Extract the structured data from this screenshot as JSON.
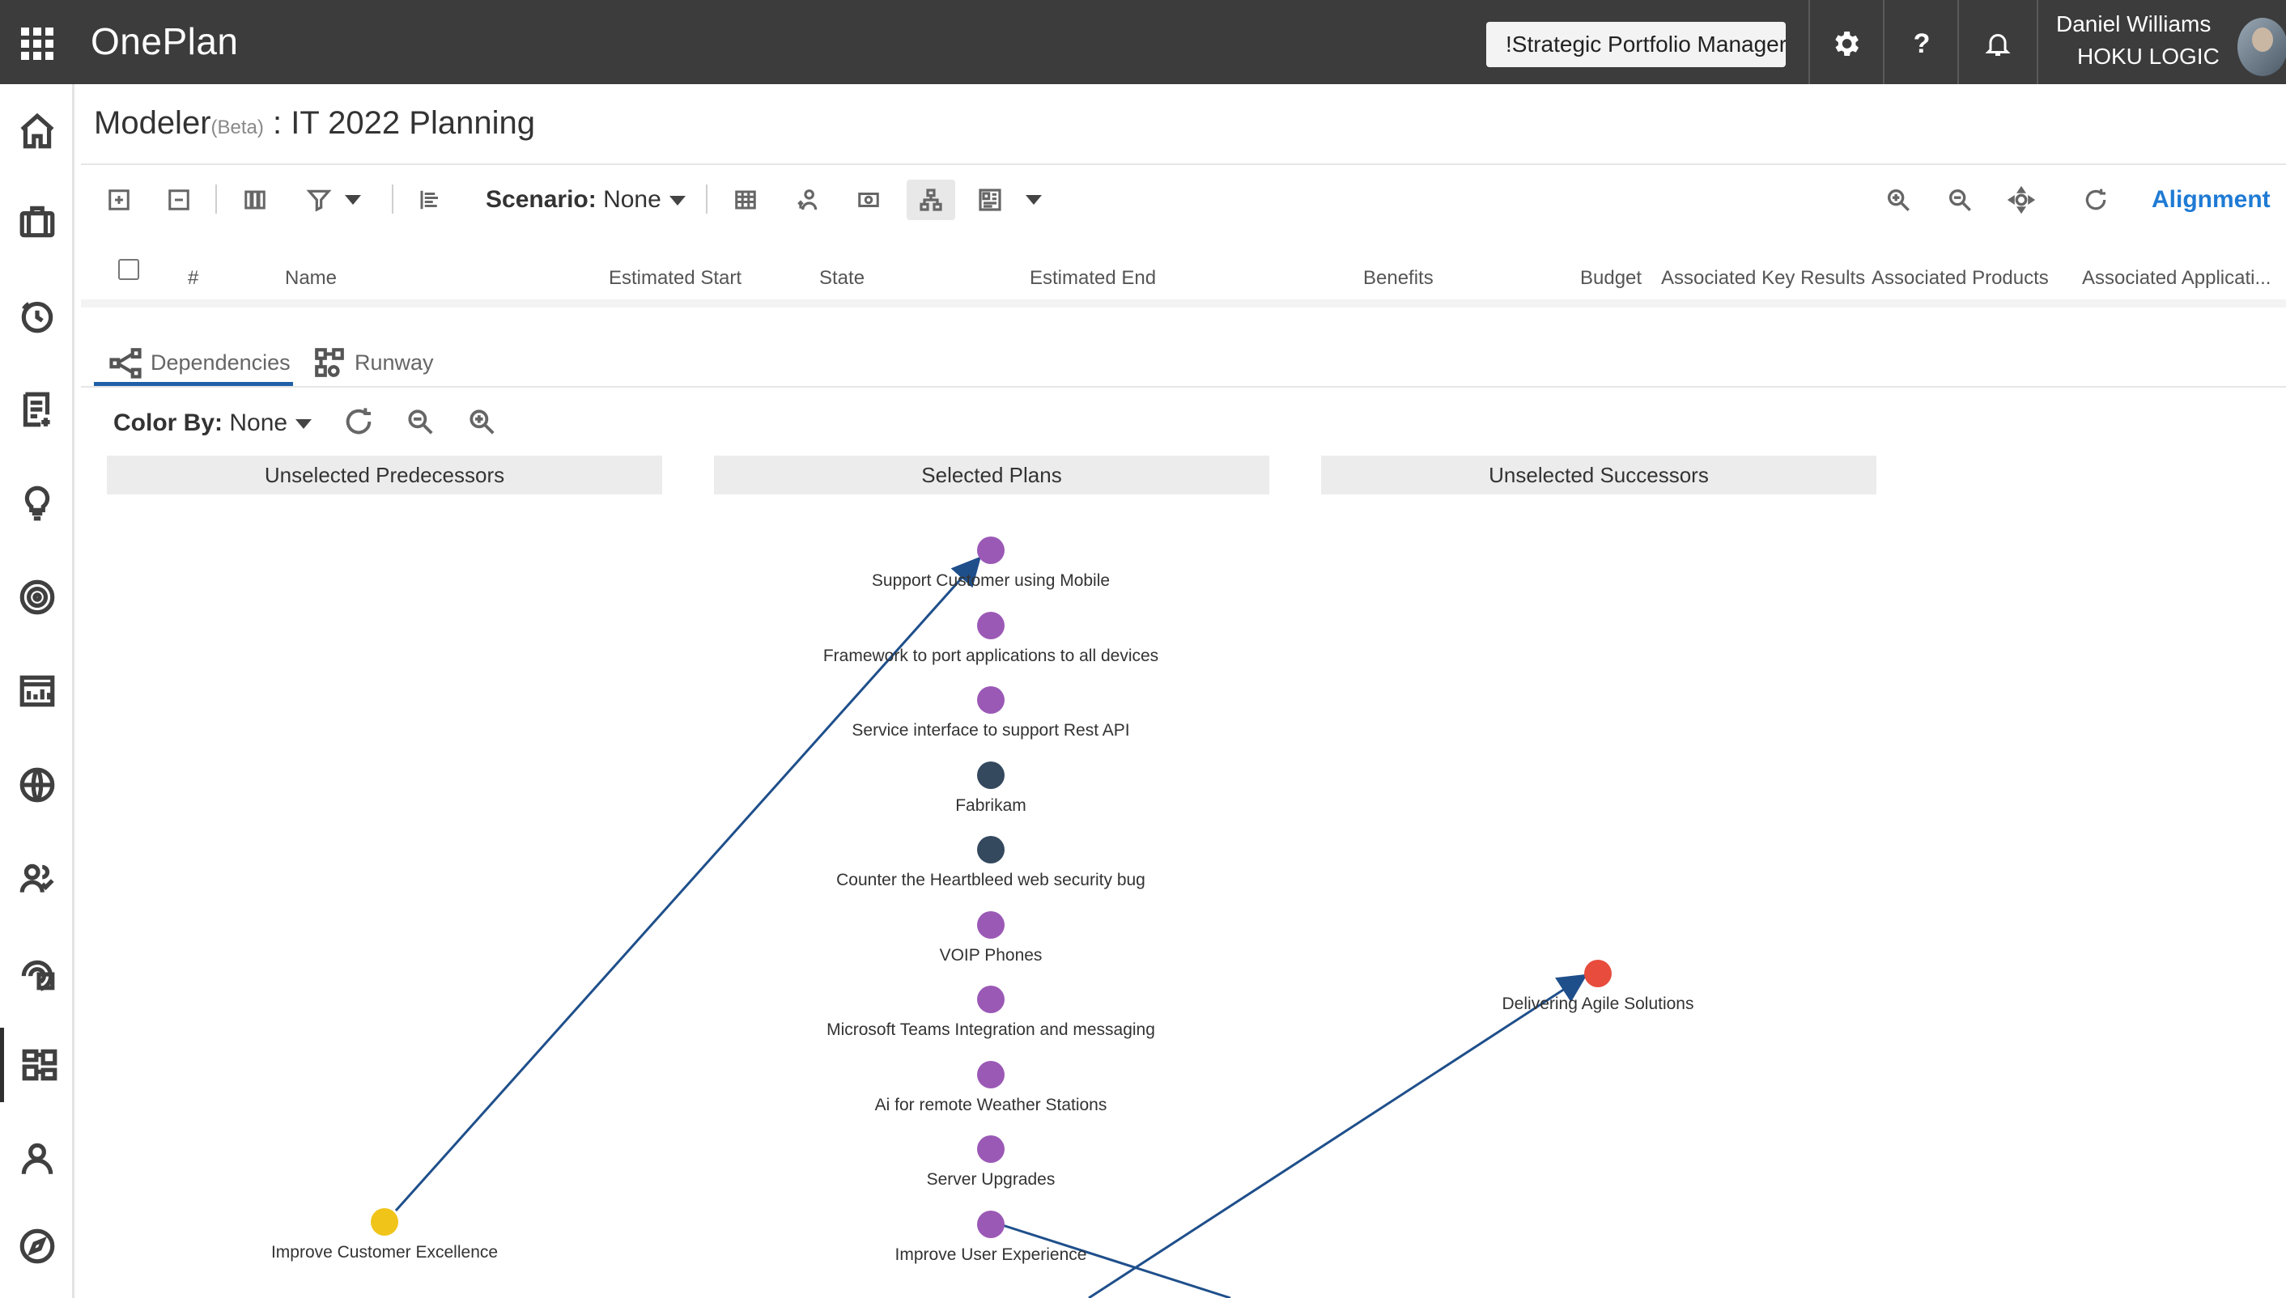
{
  "app": {
    "brand": "OnePlan",
    "portfolio_selector": "!Strategic Portfolio Manager",
    "user_name": "Daniel Williams",
    "user_org": "HOKU LOGIC"
  },
  "header": {
    "title_prefix": "Modeler",
    "beta": "(Beta)",
    "title_suffix": ": IT 2022 Planning"
  },
  "toolbar": {
    "scenario_label": "Scenario:",
    "scenario_value": "None",
    "alignment_label": "Alignment"
  },
  "grid": {
    "columns": [
      "#",
      "Name",
      "Estimated Start",
      "State",
      "Estimated End",
      "Benefits",
      "Budget",
      "Associated Key Results",
      "Associated Products",
      "Associated Applicati..."
    ]
  },
  "tabs": [
    {
      "label": "Dependencies",
      "active": true
    },
    {
      "label": "Runway",
      "active": false
    }
  ],
  "dependencies": {
    "color_by_label": "Color By:",
    "color_by_value": "None",
    "lanes": [
      "Unselected Predecessors",
      "Selected Plans",
      "Unselected Successors"
    ],
    "nodes": [
      {
        "label": "Support Customer using Mobile",
        "lane": 1,
        "color": "#9b59b6"
      },
      {
        "label": "Framework to port applications to all devices",
        "lane": 1,
        "color": "#9b59b6"
      },
      {
        "label": "Service interface to support Rest API",
        "lane": 1,
        "color": "#9b59b6"
      },
      {
        "label": "Fabrikam",
        "lane": 1,
        "color": "#34495e"
      },
      {
        "label": "Counter the Heartbleed web security bug",
        "lane": 1,
        "color": "#34495e"
      },
      {
        "label": "VOIP Phones",
        "lane": 1,
        "color": "#9b59b6"
      },
      {
        "label": "Microsoft Teams Integration and messaging",
        "lane": 1,
        "color": "#9b59b6"
      },
      {
        "label": "Ai for remote Weather Stations",
        "lane": 1,
        "color": "#9b59b6"
      },
      {
        "label": "Server Upgrades",
        "lane": 1,
        "color": "#9b59b6"
      },
      {
        "label": "Improve User Experience",
        "lane": 1,
        "color": "#9b59b6"
      },
      {
        "label": "Improve Customer Excellence",
        "lane": 0,
        "color": "#f0c419"
      },
      {
        "label": "Delivering Agile Solutions",
        "lane": 2,
        "color": "#e74c3c"
      }
    ],
    "link_color": "#1f4f8b"
  }
}
